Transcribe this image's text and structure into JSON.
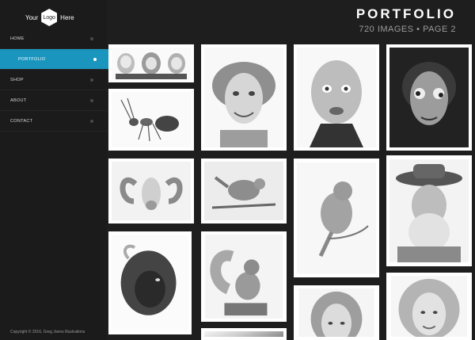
{
  "logo": {
    "text_left": "Your",
    "text_mark": "Logo",
    "text_right": "Here"
  },
  "nav": [
    {
      "label": "HOME",
      "active": false
    },
    {
      "label": "PORTFOLIO",
      "active": true
    },
    {
      "label": "SHOP",
      "active": false
    },
    {
      "label": "ABOUT",
      "active": false
    },
    {
      "label": "CONTACT",
      "active": false
    }
  ],
  "header": {
    "title": "PORTFOLIO",
    "subtitle": "720 IMAGES • PAGE 2"
  },
  "footer": {
    "copyright": "Copyright © 2016, Greg Joens Illustrations"
  },
  "colors": {
    "accent": "#1a95be",
    "sidebar": "#1b1b1b",
    "background": "#1e1e1e"
  },
  "gallery": [
    {
      "subject": "three-stooges-icon"
    },
    {
      "subject": "larry-portrait-icon"
    },
    {
      "subject": "curly-portrait-icon"
    },
    {
      "subject": "marty-feldman-portrait-icon"
    },
    {
      "subject": "ant-icon"
    },
    {
      "subject": "ram-icon"
    },
    {
      "subject": "wren-icon"
    },
    {
      "subject": "songbird-icon"
    },
    {
      "subject": "cowboy-portrait-icon"
    },
    {
      "subject": "bison-icon"
    },
    {
      "subject": "squirrel-icon"
    },
    {
      "subject": "woman-portrait-icon"
    },
    {
      "subject": "farrah-portrait-icon"
    }
  ]
}
